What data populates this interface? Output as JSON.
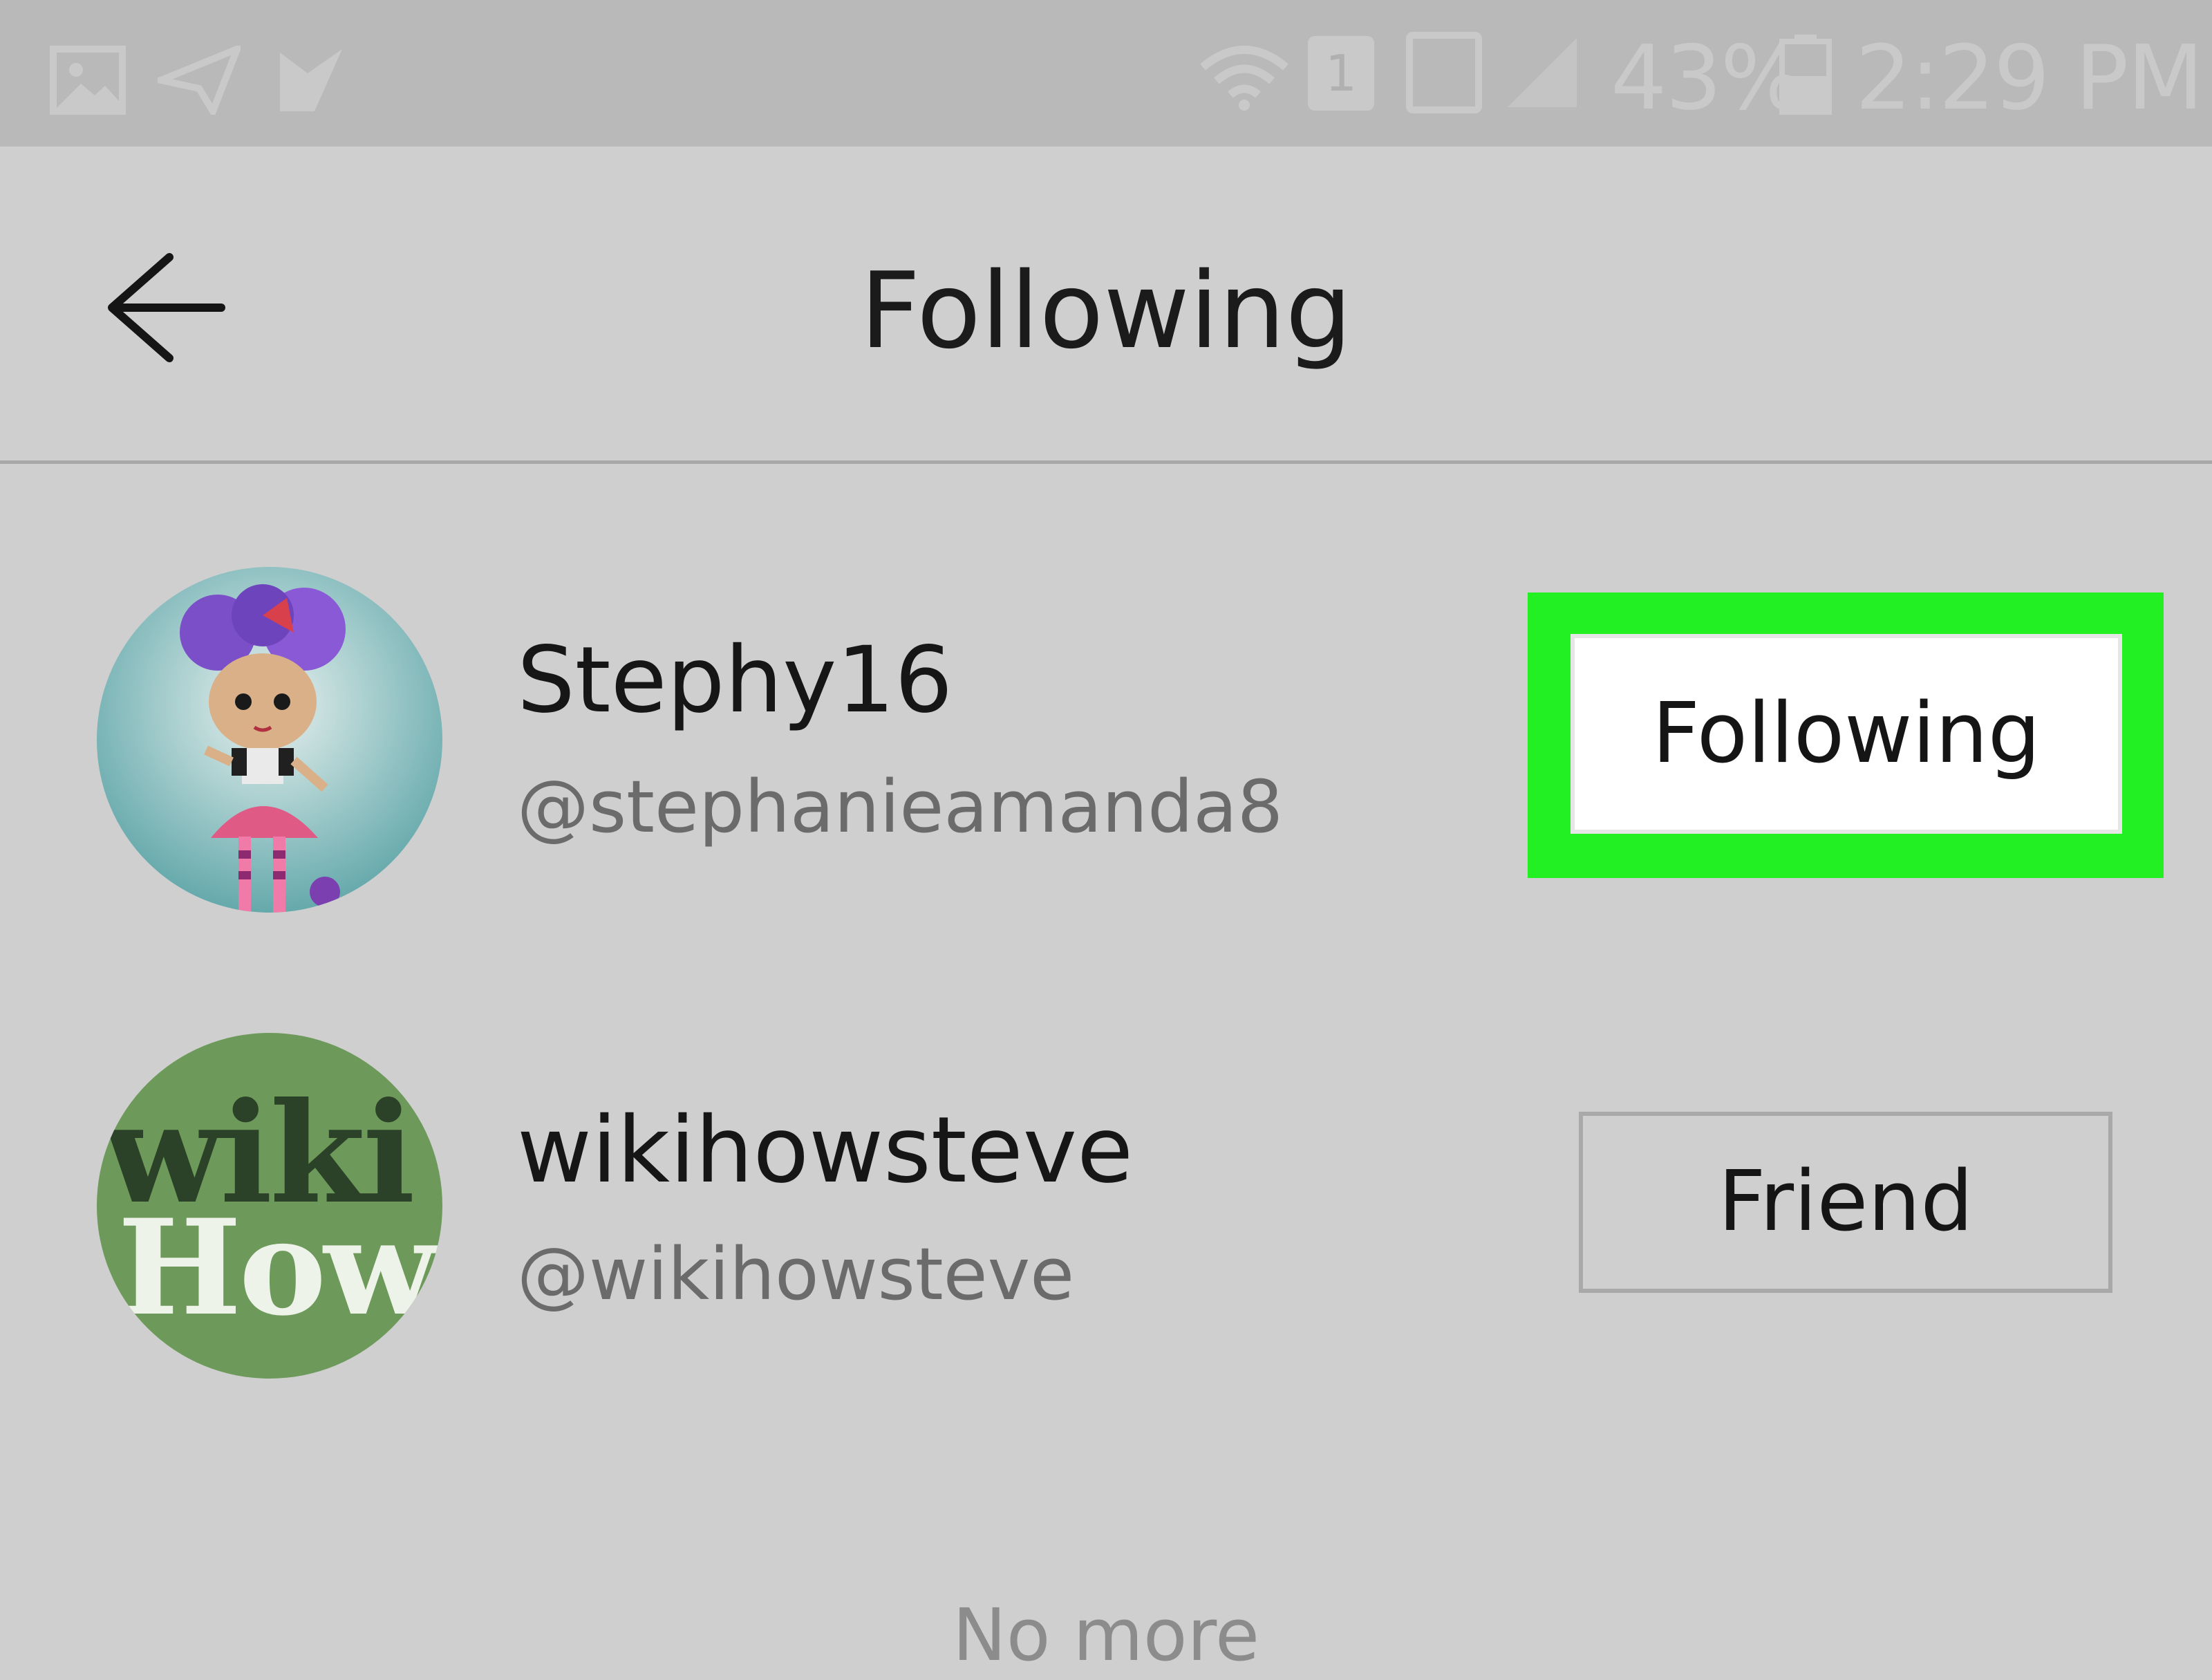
{
  "status_bar": {
    "icons_left": [
      "image-icon",
      "send-icon",
      "check-icon"
    ],
    "icons_right": [
      "wifi-icon",
      "sim-icon",
      "nfc-icon",
      "signal-icon",
      "battery-icon"
    ],
    "sim_slot": "1",
    "battery": "43%",
    "time": "2:29 PM"
  },
  "header": {
    "title": "Following",
    "back_icon": "arrow-left-icon"
  },
  "users": [
    {
      "name": "Stephy16",
      "handle": "@stephanieamanda8",
      "button": "Following",
      "avatar": "doll-avatar"
    },
    {
      "name": "wikihowsteve",
      "handle": "@wikihowsteve",
      "button": "Friend",
      "avatar": "wikihow-avatar",
      "avatar_text": [
        "wiki",
        "How"
      ]
    }
  ],
  "footer": {
    "text": "No more"
  },
  "colors": {
    "highlight": "#22f022",
    "background": "#cfcfcf",
    "status_bar": "#b9b9b9"
  }
}
